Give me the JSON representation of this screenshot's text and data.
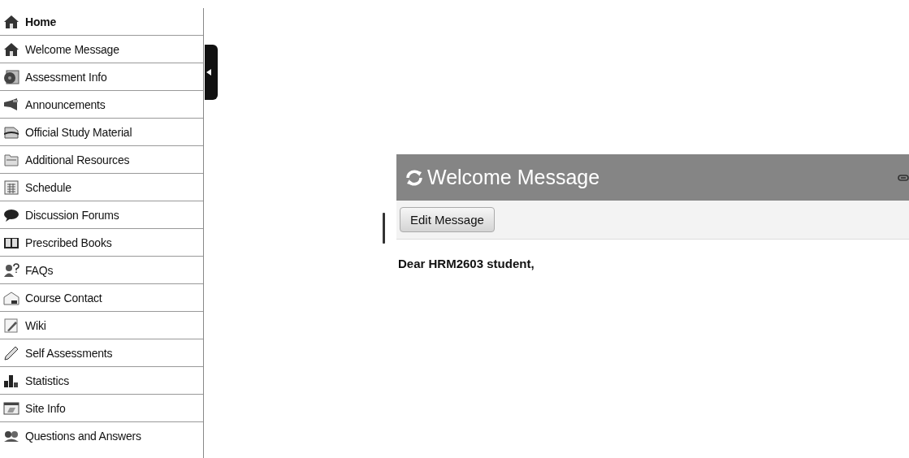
{
  "sidebar": {
    "items": [
      {
        "label": "Home",
        "kind": "house",
        "heading": true
      },
      {
        "label": "Welcome Message",
        "kind": "house",
        "heading": false
      },
      {
        "label": "Assessment Info",
        "kind": "disc",
        "heading": false
      },
      {
        "label": "Announcements",
        "kind": "megaphone",
        "heading": false
      },
      {
        "label": "Official Study Material",
        "kind": "tray",
        "heading": false
      },
      {
        "label": "Additional Resources",
        "kind": "folder",
        "heading": false
      },
      {
        "label": "Schedule",
        "kind": "calendar",
        "heading": false
      },
      {
        "label": "Discussion Forums",
        "kind": "bubble",
        "heading": false
      },
      {
        "label": "Prescribed Books",
        "kind": "book",
        "heading": false
      },
      {
        "label": "FAQs",
        "kind": "people",
        "heading": false
      },
      {
        "label": "Course Contact",
        "kind": "envelope",
        "heading": false
      },
      {
        "label": "Wiki",
        "kind": "pencil-page",
        "heading": false
      },
      {
        "label": "Self Assessments",
        "kind": "pencil",
        "heading": false
      },
      {
        "label": "Statistics",
        "kind": "bars",
        "heading": false
      },
      {
        "label": "Site Info",
        "kind": "window",
        "heading": false
      },
      {
        "label": "Questions and Answers",
        "kind": "qa",
        "heading": false
      }
    ]
  },
  "panel": {
    "title": "Welcome Message",
    "button": "Edit Message",
    "message": "Dear HRM2603 student,"
  }
}
